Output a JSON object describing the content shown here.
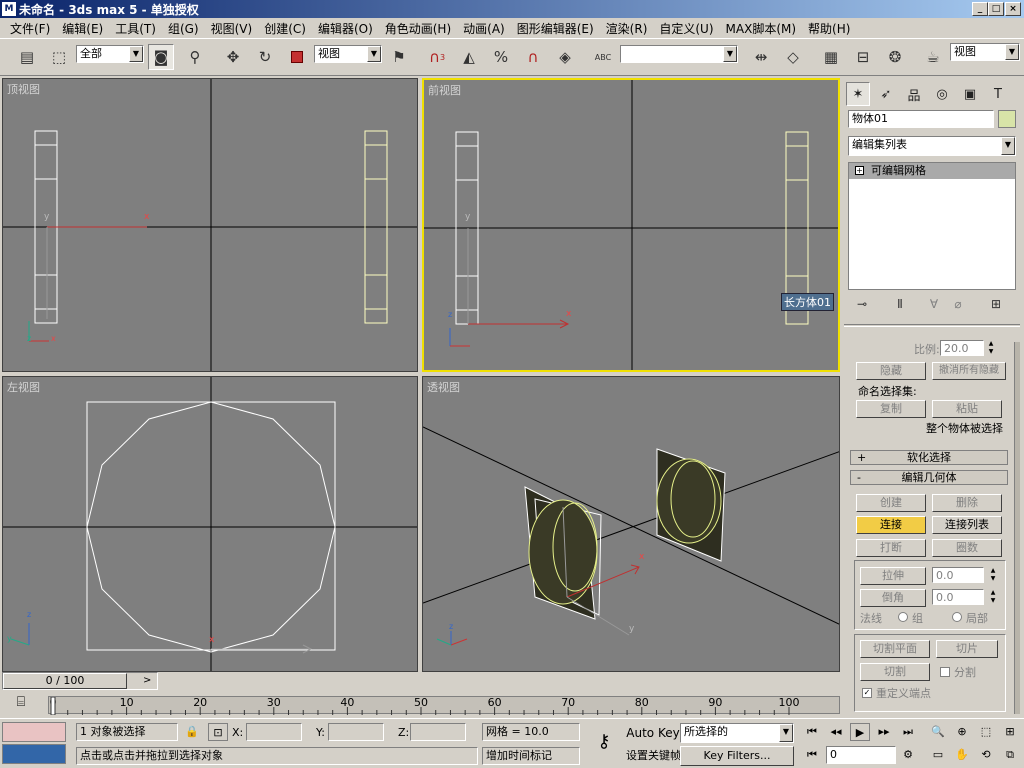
{
  "window": {
    "title": "未命名 - 3ds max 5 - 单独授权",
    "app_icon": "3ds-max-icon",
    "min": "_",
    "max": "□",
    "close": "×"
  },
  "menu": [
    "文件(F)",
    "编辑(E)",
    "工具(T)",
    "组(G)",
    "视图(V)",
    "创建(C)",
    "编辑器(O)",
    "角色动画(H)",
    "动画(A)",
    "图形编辑器(E)",
    "渲染(R)",
    "自定义(U)",
    "MAX脚本(M)",
    "帮助(H)"
  ],
  "toolbar": {
    "selection_filter": "全部",
    "ref_coord": "视图",
    "named_selection": "",
    "view_dropdown": "视图",
    "snap_label": "3",
    "percent_label": "%",
    "abc_label": "ABC"
  },
  "viewports": {
    "top": {
      "label": "顶视图",
      "axis_x": "x",
      "axis_y": "y",
      "axis_z": "z"
    },
    "front": {
      "label": "前视图",
      "tooltip": "长方体01",
      "axis_x": "x",
      "axis_y": "y",
      "axis_z": "z"
    },
    "left": {
      "label": "左视图",
      "axis_x": "x",
      "axis_y": "y",
      "axis_z": "z"
    },
    "perspective": {
      "label": "透视图",
      "axis_x": "x",
      "axis_y": "y",
      "axis_z": "z"
    }
  },
  "command_panel": {
    "object_name": "物体01",
    "object_color": "#d8e4a8",
    "modifier_list": "编辑集列表",
    "stack_item": "可编辑网格",
    "scale_label": "比例:",
    "scale_value": "20.0",
    "hide_btn": "隐藏",
    "unhide_all_btn": "撤消所有隐藏",
    "named_sel_label": "命名选择集:",
    "copy_btn": "复制",
    "paste_btn": "粘贴",
    "whole_object": "整个物体被选择",
    "soft_selection": "软化选择",
    "edit_geometry": "编辑几何体",
    "create_btn": "创建",
    "delete_btn": "删除",
    "attach_btn": "连接",
    "attach_list_btn": "连接列表",
    "detach_btn": "打断",
    "ring_btn": "圈数",
    "extrude_btn": "拉伸",
    "extrude_value": "0.0",
    "chamfer_btn": "倒角",
    "chamfer_value": "0.0",
    "normal_label": "法线",
    "group_label": "组",
    "local_label": "局部",
    "slice_plane_btn": "切割平面",
    "slice_btn": "切片",
    "cut_btn": "切割",
    "split_label": "分割",
    "refine_ends_label": "重定义端点",
    "plus": "+",
    "minus": "-"
  },
  "timeline": {
    "slider_label": "0 / 100",
    "ticks": [
      "0",
      "10",
      "20",
      "30",
      "40",
      "50",
      "60",
      "70",
      "80",
      "90",
      "100"
    ],
    "tick_values": [
      0,
      10,
      20,
      30,
      40,
      50,
      60,
      70,
      80,
      90,
      100
    ]
  },
  "status": {
    "selected": "1 对象被选择",
    "prompt": "点击或点击并拖拉到选择对象",
    "x_label": "X:",
    "y_label": "Y:",
    "z_label": "Z:",
    "grid": "网格 = 10.0",
    "add_time_tag": "增加时间标记",
    "auto_key": "Auto Key",
    "set_key": "设置关键帧",
    "key_mode": "所选择的",
    "key_filters": "Key Filters...",
    "frame": "0"
  }
}
